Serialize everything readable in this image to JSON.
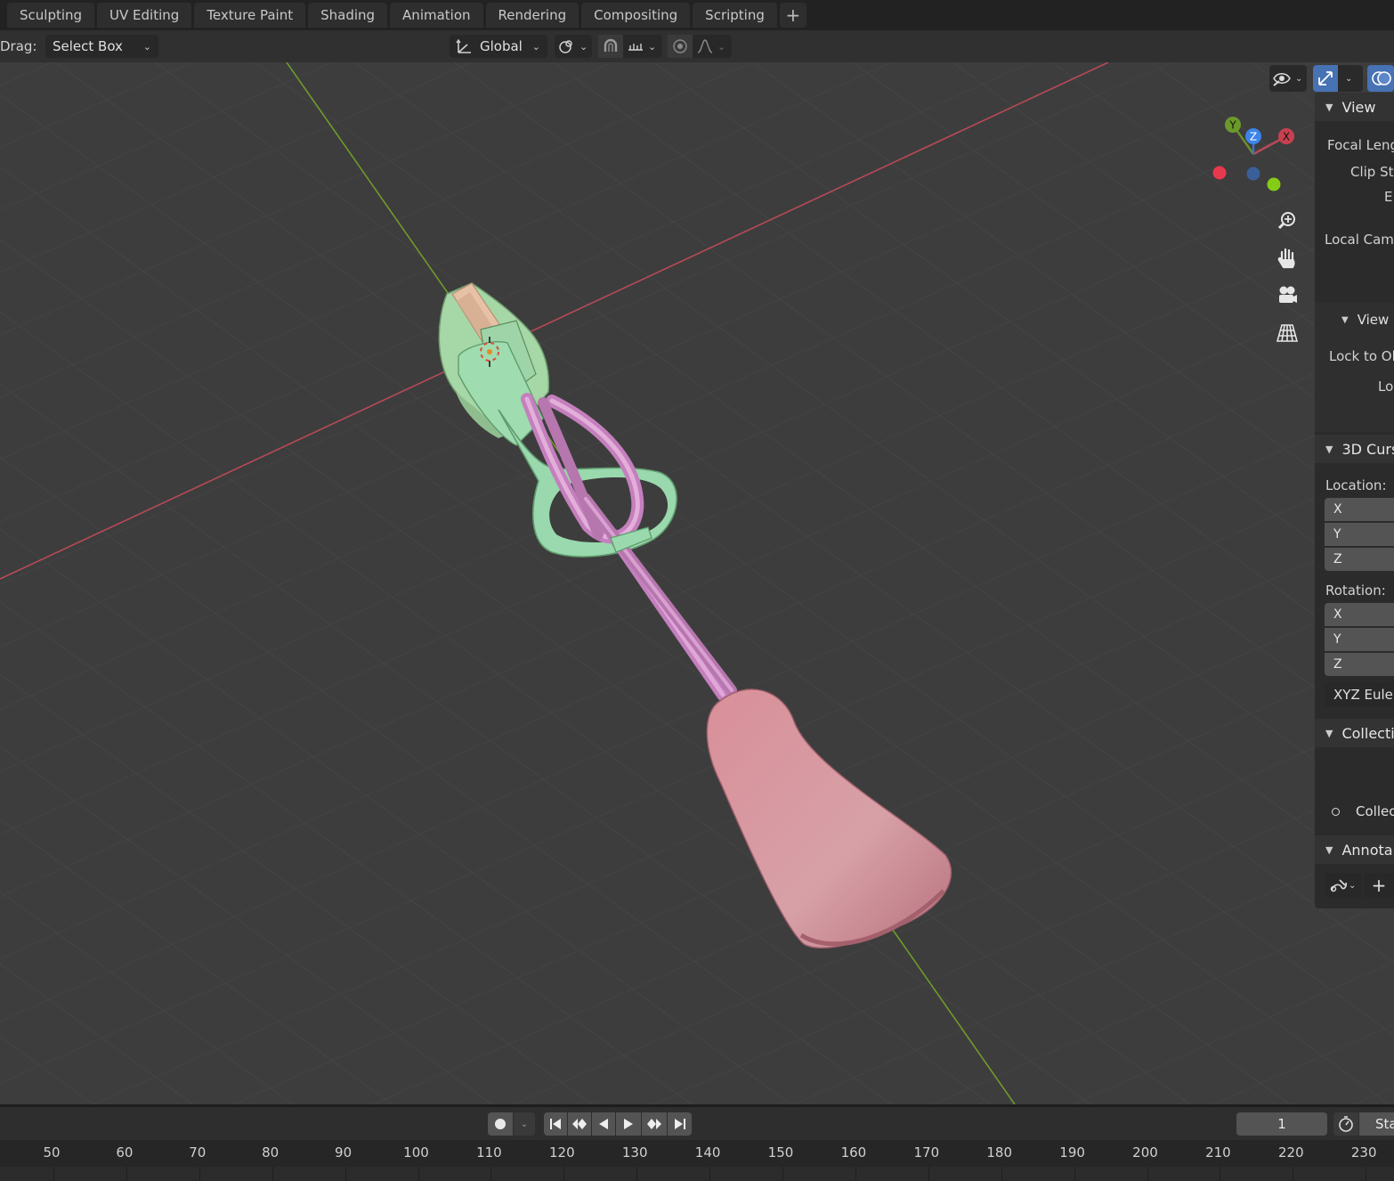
{
  "workspace_tabs": [
    "Sculpting",
    "UV Editing",
    "Texture Paint",
    "Shading",
    "Animation",
    "Rendering",
    "Compositing",
    "Scripting"
  ],
  "add_tab_label": "+",
  "tool_header": {
    "drag_label": "Drag:",
    "drag_value": "Select Box",
    "orientation_value": "Global"
  },
  "gizmo": {
    "x_label": "X",
    "y_label": "Y",
    "z_label": "Z"
  },
  "sidebar": {
    "view_header": "View",
    "focal_length": "Focal Leng",
    "clip_start": "Clip Sta",
    "clip_end": "E",
    "local_camera": "Local Came",
    "view_lock_header": "View",
    "lock_to_object": "Lock to Ob",
    "lock": "Lo",
    "cursor_header": "3D Curs",
    "location_label": "Location:",
    "location_axes": [
      "X",
      "Y",
      "Z"
    ],
    "rotation_label": "Rotation:",
    "rotation_axes": [
      "X",
      "Y",
      "Z"
    ],
    "rotation_mode": "XYZ Euler",
    "collections_header": "Collecti",
    "collection_item": "Collec",
    "annotations_header": "Annota",
    "annotations_add": "+"
  },
  "timeline": {
    "current_frame": "1",
    "start_label": "Sta",
    "ruler_ticks": [
      "50",
      "60",
      "70",
      "80",
      "90",
      "100",
      "110",
      "120",
      "130",
      "140",
      "150",
      "160",
      "170",
      "180",
      "190",
      "200",
      "210",
      "220",
      "230"
    ]
  },
  "colors": {
    "x_axis": "#d64a5a",
    "y_axis": "#7cab2a",
    "slider_green": "#a8dca8",
    "pull_tab_pink": "#d4939d",
    "active_blue": "#4772b3"
  }
}
